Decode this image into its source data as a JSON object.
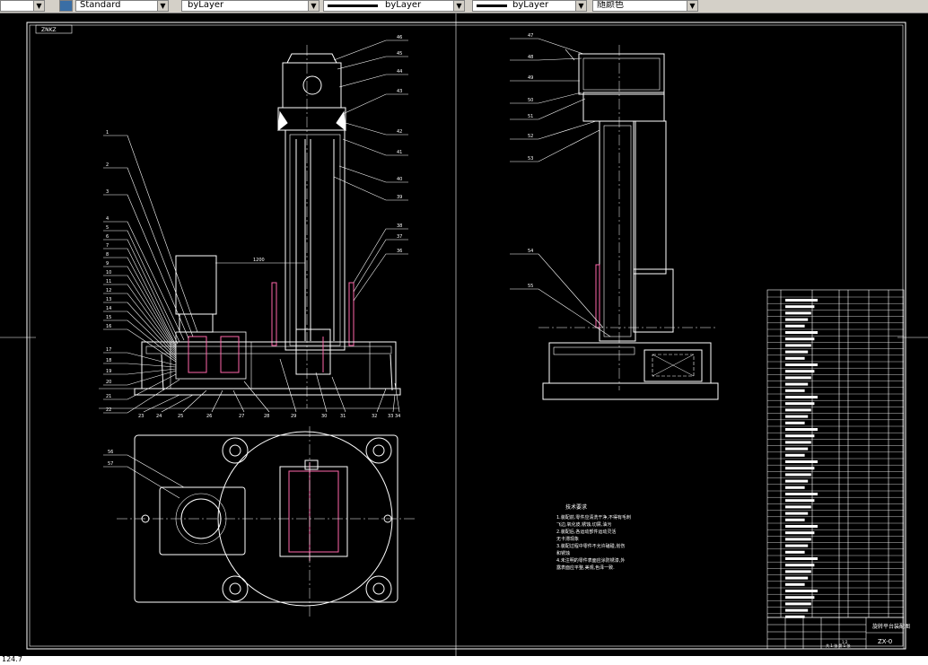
{
  "toolbar": {
    "text_style": "Standard",
    "layer": "byLayer",
    "linetype": "byLayer",
    "lineweight": "byLayer",
    "plot_style": "随颜色"
  },
  "drawing": {
    "frame_tag": "ZNKZ",
    "tech_title": "技术要求",
    "tech_requirements": [
      "1.装配前,零件应清洗干净,不得有毛刺",
      "   飞边,氧化皮,锈蚀,切屑,油污",
      "2.装配后,各运动部件运动灵活",
      "   无卡滞现象",
      "3.装配过程中零件不允许磕碰,划伤",
      "   和锈蚀",
      "4.未注明的零件表面应涂防锈漆,外",
      "   露表面应平整,美观,色泽一致."
    ],
    "title_block": {
      "name": "旋转平台装配图",
      "code": "ZX-0",
      "scale": "1:2",
      "sheet": "共 1 张 第 1 张"
    },
    "callouts_front_left": [
      "1",
      "2",
      "3",
      "4",
      "5",
      "6",
      "7",
      "8",
      "9",
      "10",
      "11",
      "12",
      "13",
      "14",
      "15",
      "16",
      "17",
      "18",
      "19",
      "20",
      "21",
      "22"
    ],
    "callouts_front_bottom": [
      "23",
      "24",
      "25",
      "26",
      "27",
      "28",
      "29",
      "30",
      "31",
      "32",
      "33",
      "34"
    ],
    "callouts_front_right": [
      "46",
      "45",
      "44",
      "43",
      "42",
      "41",
      "40",
      "39",
      "38",
      "37",
      "36"
    ],
    "callouts_side_left": [
      "47",
      "48",
      "49",
      "50",
      "51",
      "52",
      "53",
      "54",
      "55"
    ],
    "callouts_plan": [
      "56",
      "57"
    ],
    "dimension_label": "1200"
  },
  "status": {
    "coordinates": "124.7"
  }
}
